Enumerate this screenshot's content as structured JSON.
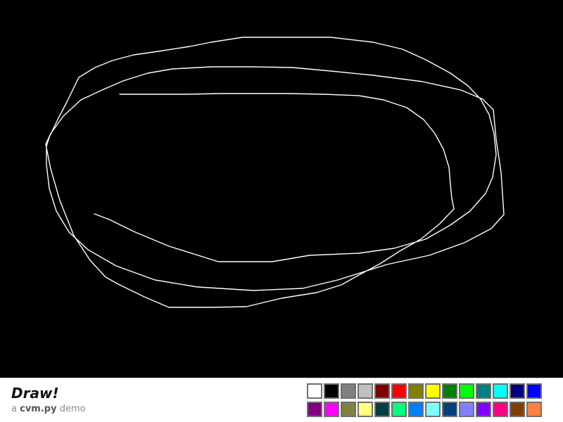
{
  "app": {
    "title": "Draw!",
    "subtitle_prefix": "a ",
    "subtitle_bold": "cvm.py",
    "subtitle_suffix": " demo"
  },
  "canvas": {
    "background": "#000000",
    "stroke_color": "#ffffff"
  },
  "palette": {
    "row1": [
      "#ffffff",
      "#000000",
      "#808080",
      "#c0c0c0",
      "#800000",
      "#ff0000",
      "#808000",
      "#ffff00",
      "#008000",
      "#00ff00",
      "#008080",
      "#00ffff",
      "#000080",
      "#0000ff"
    ],
    "row2": [
      "#800080",
      "#ff00ff",
      "#808040",
      "#ffff80",
      "#004040",
      "#00ff80",
      "#0080ff",
      "#80ffff",
      "#004080",
      "#8080ff",
      "#8000ff",
      "#ff0080",
      "#804000",
      "#ff8040"
    ]
  }
}
